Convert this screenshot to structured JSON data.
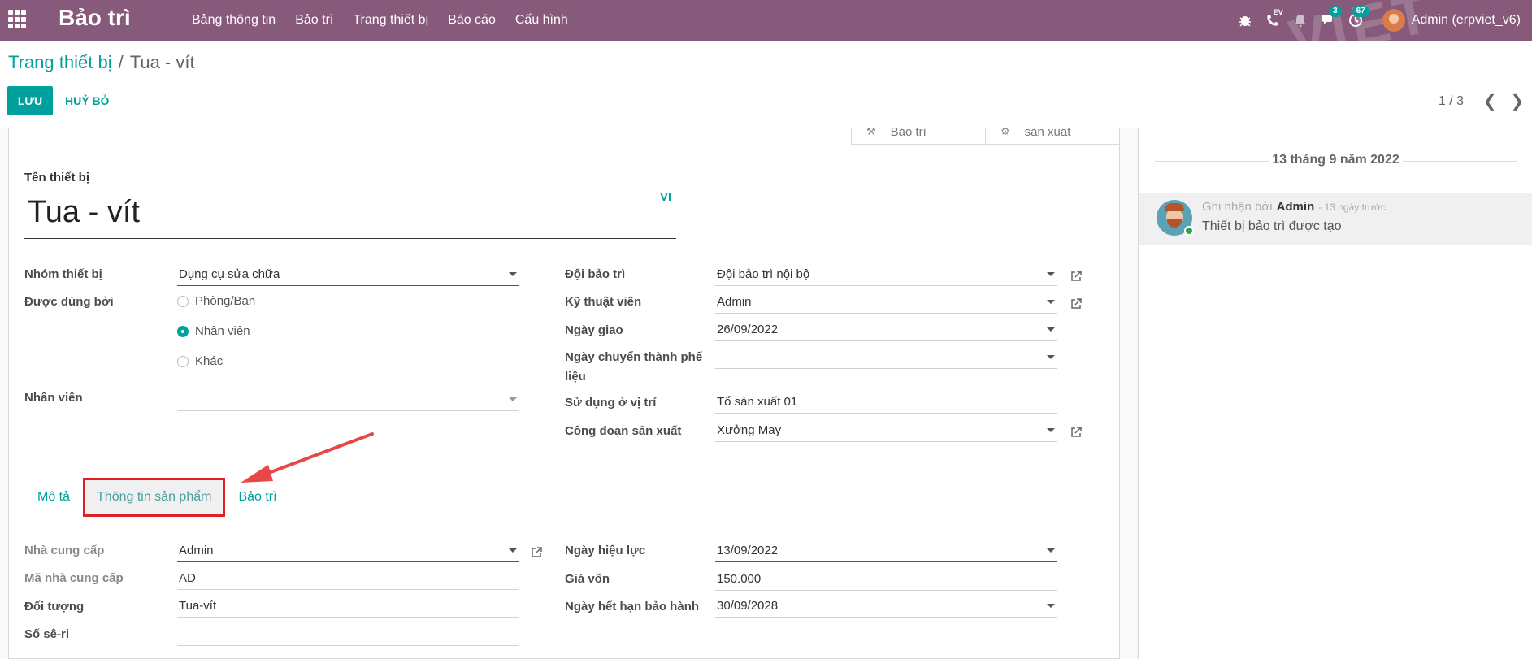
{
  "navbar": {
    "brand": "Bảo trì",
    "menu": [
      "Bảng thông tin",
      "Bảo trì",
      "Trang thiết bị",
      "Báo cáo",
      "Cấu hình"
    ],
    "ev_label": "EV",
    "messages_count": "3",
    "activities_count": "67",
    "user": "Admin (erpviet_v6)",
    "accent_color": "#875a7b"
  },
  "breadcrumb": {
    "parent": "Trang thiết bị",
    "separator": "/",
    "current": "Tua - vít"
  },
  "actions": {
    "save": "LƯU",
    "discard": "HUỶ BỎ"
  },
  "pager": {
    "value": "1 / 3"
  },
  "smart_buttons": [
    "Bảo trì",
    "sản xuất"
  ],
  "form": {
    "name_label": "Tên thiết bị",
    "name_value": "Tua - vít",
    "lang": "VI",
    "left": {
      "category_label": "Nhóm thiết bị",
      "category_value": "Dụng cụ sửa chữa",
      "used_by_label": "Được dùng bởi",
      "used_by_options": [
        "Phòng/Ban",
        "Nhân viên",
        "Khác"
      ],
      "used_by_selected": "Nhân viên",
      "employee_label": "Nhân viên",
      "employee_value": ""
    },
    "right": {
      "team_label": "Đội bảo trì",
      "team_value": "Đội bảo trì nội bộ",
      "tech_label": "Kỹ thuật viên",
      "tech_value": "Admin",
      "assign_date_label": "Ngày giao",
      "assign_date_value": "26/09/2022",
      "scrap_date_label": "Ngày chuyển thành phế liệu",
      "scrap_date_value": "",
      "location_label": "Sử dụng ở vị trí",
      "location_value": "Tổ sản xuất 01",
      "workcenter_label": "Công đoạn sản xuất",
      "workcenter_value": "Xưởng May"
    },
    "tabs": [
      "Mô tả",
      "Thông tin sản phẩm",
      "Bảo trì"
    ],
    "active_tab": "Thông tin sản phẩm",
    "product": {
      "vendor_label": "Nhà cung cấp",
      "vendor_value": "Admin",
      "vendor_ref_label": "Mã nhà cung cấp",
      "vendor_ref_value": "AD",
      "model_label": "Đối tượng",
      "model_value": "Tua-vít",
      "serial_label": "Số sê-ri",
      "serial_value": "",
      "effective_date_label": "Ngày hiệu lực",
      "effective_date_value": "13/09/2022",
      "cost_label": "Giá vốn",
      "cost_value": "150.000",
      "warranty_label": "Ngày hết hạn bảo hành",
      "warranty_value": "30/09/2028"
    }
  },
  "chatter": {
    "date": "13 tháng 9 năm 2022",
    "message": {
      "prefix": "Ghi nhận bởi",
      "author": "Admin",
      "time": "- 13 ngày trước",
      "body": "Thiết bị bảo trì được tạo"
    }
  }
}
